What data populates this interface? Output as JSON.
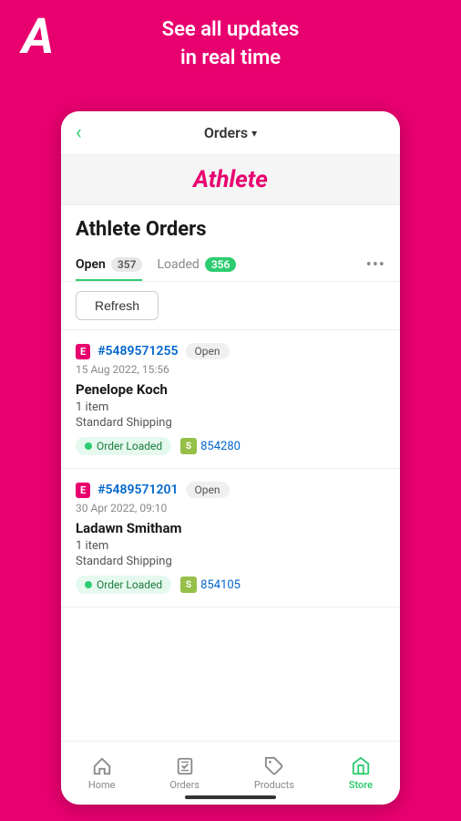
{
  "background_color": "#E8006F",
  "header": {
    "logo_letter": "A",
    "tagline_line1": "See all updates",
    "tagline_line2": "in real time"
  },
  "nav": {
    "back_icon": "‹",
    "title": "Orders",
    "dropdown_icon": "▾"
  },
  "brand": {
    "name": "Athlete"
  },
  "page": {
    "title": "Athlete Orders"
  },
  "tabs": [
    {
      "label": "Open",
      "badge": "357",
      "badge_type": "open",
      "active": true
    },
    {
      "label": "Loaded",
      "badge": "356",
      "badge_type": "loaded",
      "active": false
    }
  ],
  "tabs_more": "•••",
  "refresh_button": "Refresh",
  "orders": [
    {
      "source": "E",
      "number": "#5489571255",
      "status": "Open",
      "date": "15 Aug 2022, 15:56",
      "customer": "Penelope Koch",
      "items": "1 item",
      "shipping": "Standard Shipping",
      "loaded_label": "Order Loaded",
      "shopify_order": "854280"
    },
    {
      "source": "E",
      "number": "#5489571201",
      "status": "Open",
      "date": "30 Apr 2022, 09:10",
      "customer": "Ladawn Smitham",
      "items": "1 item",
      "shipping": "Standard Shipping",
      "loaded_label": "Order Loaded",
      "shopify_order": "854105"
    }
  ],
  "bottom_nav": [
    {
      "label": "Home",
      "icon": "⌂",
      "active": false
    },
    {
      "label": "Orders",
      "icon": "↓▭",
      "active": false
    },
    {
      "label": "Products",
      "icon": "🏷",
      "active": false
    },
    {
      "label": "Store",
      "icon": "▦",
      "active": true
    }
  ]
}
